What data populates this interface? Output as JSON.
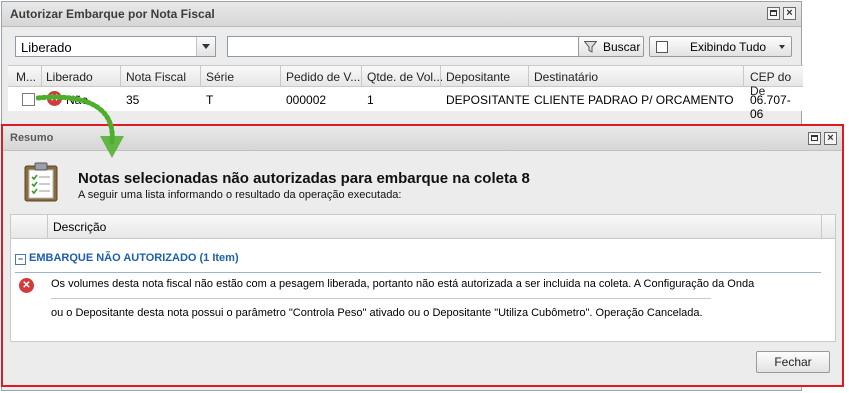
{
  "window_main": {
    "title": "Autorizar Embarque por Nota Fiscal",
    "filter_select": {
      "value": "Liberado"
    },
    "search": {
      "value": ""
    },
    "search_button": "Buscar",
    "display_button": "Exibindo Tudo",
    "columns": [
      "M...",
      "Liberado",
      "Nota Fiscal",
      "Série",
      "Pedido de V...",
      "Qtde. de Vol...",
      "Depositante",
      "Destinatário",
      "CEP do De"
    ],
    "rows": [
      {
        "liberado": "Não",
        "nota_fiscal": "35",
        "serie": "T",
        "pedido": "000002",
        "qtde_vol": "1",
        "depositante": "DEPOSITANTE",
        "destinatario": "CLIENTE PADRAO P/ ORCAMENTO",
        "cep": "06.707-06"
      }
    ]
  },
  "dialog": {
    "title": "Resumo",
    "heading": "Notas selecionadas não autorizadas para embarque na coleta 8",
    "subheading": "A seguir uma lista informando o resultado da operação executada:",
    "column": "Descrição",
    "group_label": "EMBARQUE NÃO AUTORIZADO (1 Item)",
    "group_toggle": "−",
    "message_line1": "Os volumes desta nota fiscal não estão com a pesagem liberada, portanto não está autorizada a ser incluida na coleta. A Configuração da Onda",
    "message_line2": "ou o Depositante desta nota possui o parâmetro \"Controla Peso\" ativado ou o Depositante \"Utiliza Cubômetro\". Operação Cancelada.",
    "close_button": "Fechar"
  },
  "icons": {
    "error": "x-circle-icon",
    "clipboard": "clipboard-checklist-icon",
    "filter": "funnel-icon",
    "arrow": "green-dotted-arrow"
  },
  "colors": {
    "highlight_border": "#e01a22",
    "group_text": "#1d5fa8",
    "error_red": "#d13b3b",
    "arrow_green": "#4caf2a"
  }
}
